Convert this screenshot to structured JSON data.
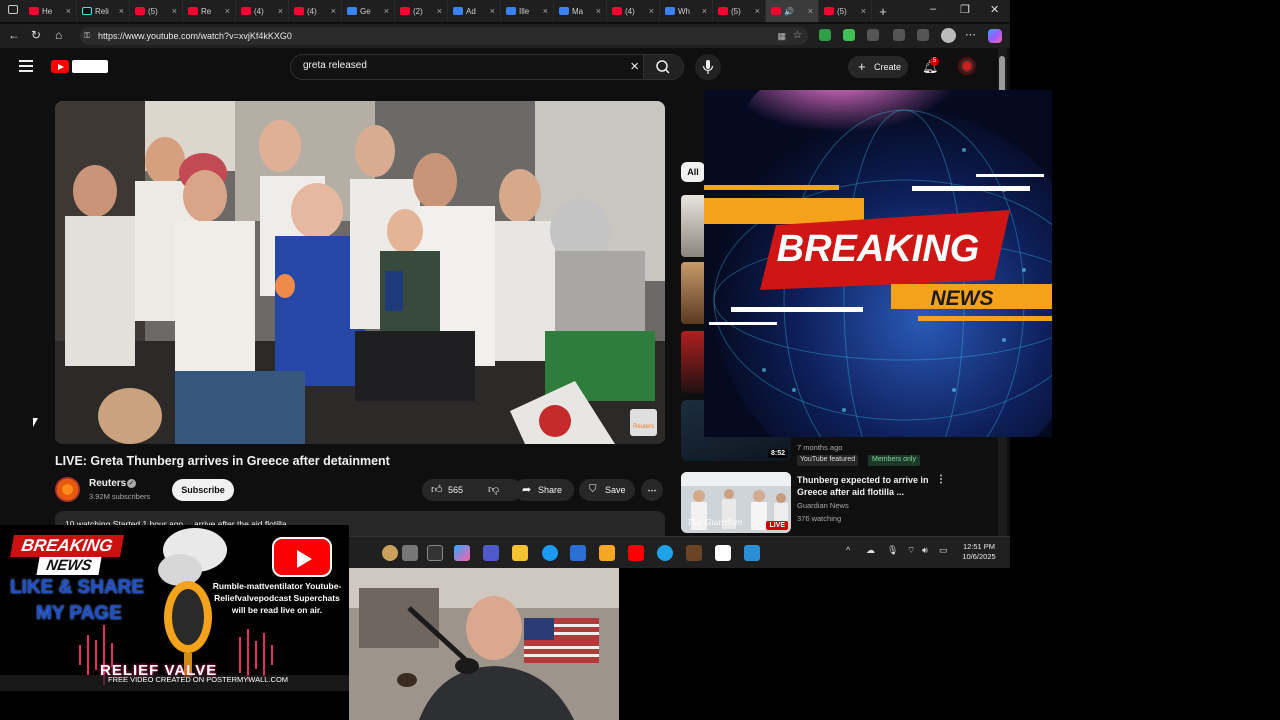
{
  "browser": {
    "tabs": [
      {
        "label": "He",
        "icon": "youtube-icon"
      },
      {
        "label": "Reli",
        "icon": "tiktok-icon"
      },
      {
        "label": "(5)",
        "icon": "youtube-icon"
      },
      {
        "label": "Re",
        "icon": "youtube-icon"
      },
      {
        "label": "(4)",
        "icon": "youtube-icon"
      },
      {
        "label": "(4)",
        "icon": "youtube-icon"
      },
      {
        "label": "Ge",
        "icon": "web-icon"
      },
      {
        "label": "(2)",
        "icon": "youtube-icon"
      },
      {
        "label": "Ad",
        "icon": "web-icon"
      },
      {
        "label": "Ille",
        "icon": "web-icon"
      },
      {
        "label": "Ma",
        "icon": "web-icon"
      },
      {
        "label": "(4)",
        "icon": "youtube-icon"
      },
      {
        "label": "Wh",
        "icon": "web-icon"
      },
      {
        "label": "(5)",
        "icon": "youtube-icon"
      },
      {
        "label": "",
        "icon": "youtube-icon"
      },
      {
        "label": "(5)",
        "icon": "youtube-icon"
      }
    ],
    "url": "https://www.youtube.com/watch?v=xvjKf4kKXG0"
  },
  "youtube": {
    "search_query": "greta released",
    "create_label": "Create",
    "notification_count": "5",
    "video": {
      "title": "LIVE: Greta Thunberg arrives in Greece after detainment",
      "channel": "Reuters",
      "subscribers": "3.92M subscribers",
      "subscribe_label": "Subscribe",
      "likes": "565",
      "share_label": "Share",
      "save_label": "Save",
      "description_preview": "10 watching  Started 1 hour ago  …arrive after the aid flotilla",
      "watermark": "Reuters"
    },
    "chip_all": "All",
    "recommended": [
      {
        "duration": "8:52",
        "meta": "7 months ago",
        "badge_featured": "YouTube featured",
        "badge_members": "Members only"
      },
      {
        "title": "Thunberg expected to arrive in Greece after aid flotilla ...",
        "channel": "Guardian News",
        "watching": "376 watching",
        "live_badge": "LIVE",
        "thumb_brand": "The Guardian"
      }
    ]
  },
  "taskbar": {
    "time": "12:51 PM",
    "date": "10/6/2025"
  },
  "overlay": {
    "breaking": "BREAKING",
    "news": "NEWS"
  },
  "banner": {
    "breaking": "BREAKING",
    "news": "NEWS",
    "line1": "LIKE & SHARE",
    "line2": "MY PAGE",
    "info": "Rumble-mattventilator Youtube-Reliefvalvepodcast Superchats will be read live on air.",
    "logo": "RELIEF VALVE",
    "credit": "FREE VIDEO CREATED ON POSTERMYWALL.COM"
  },
  "colors": {
    "youtube_red": "#ff0000",
    "breaking_red": "#d01515",
    "breaking_orange": "#f5a21b",
    "banner_blue": "#1c4fc9"
  }
}
